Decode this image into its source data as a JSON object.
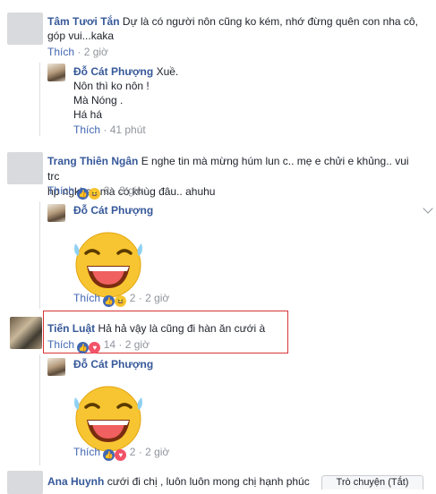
{
  "comments": [
    {
      "author": "Tâm Tươi Tắn",
      "text1": "Dự là có người nôn cũng ko kém, nhớ đừng quên con nha cô,",
      "text2": "góp vui...kaka",
      "like": "Thích",
      "time": "2 giờ"
    },
    {
      "author": "Trang Thiên Ngân",
      "text1": "E nghe tin mà mừng húm lun c.. mẹ e chửi e khủng.. vui trc",
      "text2": "hp ngkhac mà có khùg đâu.. ahuhu",
      "like": "Thích",
      "reacts": "2",
      "time": "3 giờ"
    },
    {
      "author": "Tiến Luật",
      "text1": "Hả hả vậy là cũng đi hàn ăn cưới à",
      "like": "Thích",
      "reacts": "14",
      "time": "2 giờ"
    },
    {
      "author": "Ana Huynh",
      "text1": "cưới đi chị , luôn luôn mong chị hạnh phúc"
    }
  ],
  "replies": [
    {
      "author": "Đỗ Cát Phượng",
      "text1": "Xuề.",
      "text2": "Nôn thì ko nôn !",
      "text3": "Mà Nóng .",
      "text4": "Há há",
      "like": "Thích",
      "time": "41 phút"
    },
    {
      "author": "Đỗ Cát Phượng",
      "like": "Thích",
      "reacts": "2",
      "time": "2 giờ"
    },
    {
      "author": "Đỗ Cát Phượng",
      "like": "Thích",
      "reacts": "2",
      "time": "2 giờ"
    }
  ],
  "sep": "·",
  "chat": {
    "label": "Trò chuyện (Tắt)"
  },
  "colors": {
    "name": "#365899",
    "meta": "#90949c",
    "highlight": "#d93434"
  },
  "icons": [
    "chevron-down-icon",
    "like-reaction-icon",
    "haha-reaction-icon",
    "love-reaction-icon",
    "laughing-emoji"
  ]
}
